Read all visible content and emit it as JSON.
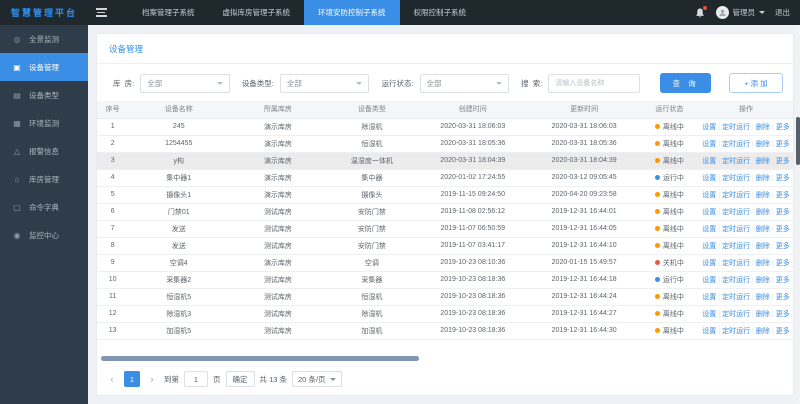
{
  "brand": "智慧管理平台",
  "topnav": {
    "tabs": [
      {
        "label": "档案管理子系统"
      },
      {
        "label": "虚拟库房管理子系统"
      },
      {
        "label": "环境安防控制子系统"
      },
      {
        "label": "权限控制子系统"
      }
    ],
    "active_index": 2,
    "user": "管理员",
    "logout": "退出"
  },
  "sidebar": {
    "active_index": 1,
    "items": [
      {
        "icon": "◎",
        "name": "panorama",
        "label": "全景监测"
      },
      {
        "icon": "▣",
        "name": "devices",
        "label": "设备管理"
      },
      {
        "icon": "▤",
        "name": "device-types",
        "label": "设备类型"
      },
      {
        "icon": "▦",
        "name": "environment",
        "label": "环境监测"
      },
      {
        "icon": "△",
        "name": "alarms",
        "label": "报警信息"
      },
      {
        "icon": "⌂",
        "name": "warehouse",
        "label": "库房管理"
      },
      {
        "icon": "▢",
        "name": "command-dict",
        "label": "命令字典"
      },
      {
        "icon": "◉",
        "name": "monitor-center",
        "label": "监控中心"
      }
    ]
  },
  "page": {
    "title": "设备管理",
    "filters": {
      "warehouse_label": "库  房:",
      "type_label": "设备类型:",
      "status_label": "运行状态:",
      "select_value": "全部",
      "search_label": "搜  索:",
      "search_placeholder": "请输入设备名称",
      "query_button": "查 询",
      "add_button": "+ 添 加"
    },
    "table": {
      "columns": [
        "序号",
        "设备名称",
        "所属库房",
        "设备类型",
        "创建时间",
        "更新时间",
        "运行状态",
        "操作"
      ],
      "actions": [
        "设置",
        "定时运行",
        "删除",
        "更多"
      ],
      "status_colors": {
        "离线中": "#ff9800",
        "运行中": "#3a8ee6",
        "关机中": "#f25643"
      },
      "rows": [
        {
          "no": "1",
          "name": "245",
          "warehouse": "演示库房",
          "type": "除湿机",
          "created": "2020-03-31 18:06:03",
          "updated": "2020-03-31 18:06:03",
          "status": "离线中",
          "highlight": false
        },
        {
          "no": "2",
          "name": "1254455",
          "warehouse": "演示库房",
          "type": "恒湿机",
          "created": "2020-03-31 18:05:36",
          "updated": "2020-03-31 18:05:36",
          "status": "离线中",
          "highlight": false
        },
        {
          "no": "3",
          "name": "y构",
          "warehouse": "演示库房",
          "type": "温湿度一体机",
          "created": "2020-03-31 18:04:39",
          "updated": "2020-03-31 18:04:39",
          "status": "离线中",
          "highlight": true
        },
        {
          "no": "4",
          "name": "集中器1",
          "warehouse": "演示库房",
          "type": "集中器",
          "created": "2020-01-02 17:24:55",
          "updated": "2020-03-12 09:05:45",
          "status": "运行中",
          "highlight": false
        },
        {
          "no": "5",
          "name": "摄像头1",
          "warehouse": "演示库房",
          "type": "摄像头",
          "created": "2019-11-15 09:24:50",
          "updated": "2020-04-20 09:23:58",
          "status": "离线中",
          "highlight": false
        },
        {
          "no": "6",
          "name": "门禁01",
          "warehouse": "测试库房",
          "type": "安防门禁",
          "created": "2019-11-08 02:56:12",
          "updated": "2019-12-31 16:44:01",
          "status": "离线中",
          "highlight": false
        },
        {
          "no": "7",
          "name": "发送",
          "warehouse": "测试库房",
          "type": "安防门禁",
          "created": "2019-11-07 06:50:59",
          "updated": "2019-12-31 16:44:05",
          "status": "离线中",
          "highlight": false
        },
        {
          "no": "8",
          "name": "发送",
          "warehouse": "测试库房",
          "type": "安防门禁",
          "created": "2019-11-07 03:41:17",
          "updated": "2019-12-31 16:44:10",
          "status": "离线中",
          "highlight": false
        },
        {
          "no": "9",
          "name": "空调4",
          "warehouse": "演示库房",
          "type": "空调",
          "created": "2019-10-23 08:10:36",
          "updated": "2020-01-15 15:49:57",
          "status": "关机中",
          "highlight": false
        },
        {
          "no": "10",
          "name": "采集器2",
          "warehouse": "测试库房",
          "type": "采集器",
          "created": "2019-10-23 08:18:36",
          "updated": "2019-12-31 16:44:18",
          "status": "运行中",
          "highlight": false
        },
        {
          "no": "11",
          "name": "恒湿机5",
          "warehouse": "测试库房",
          "type": "恒湿机",
          "created": "2019-10-23 08:18:36",
          "updated": "2019-12-31 16:44:24",
          "status": "离线中",
          "highlight": false
        },
        {
          "no": "12",
          "name": "除湿机3",
          "warehouse": "测试库房",
          "type": "除湿机",
          "created": "2019-10-23 08:18:36",
          "updated": "2019-12-31 16:44:27",
          "status": "离线中",
          "highlight": false
        },
        {
          "no": "13",
          "name": "加湿机5",
          "warehouse": "测试库房",
          "type": "加湿机",
          "created": "2019-10-23 08:18:36",
          "updated": "2019-12-31 16:44:30",
          "status": "离线中",
          "highlight": false
        }
      ]
    },
    "pagination": {
      "prev": "‹",
      "page": "1",
      "next": "›",
      "goto_label": "到第",
      "goto_value": "1",
      "page_unit": "页",
      "confirm": "确定",
      "total": "共 13 条",
      "page_size": "20 条/页"
    }
  }
}
